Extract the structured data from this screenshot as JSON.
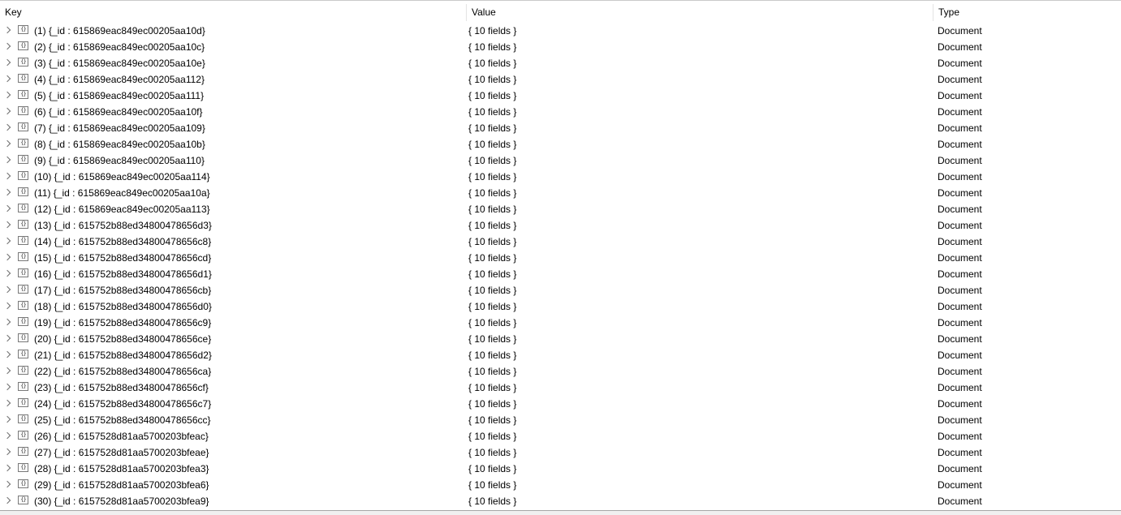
{
  "columns": {
    "key": "Key",
    "value": "Value",
    "type": "Type"
  },
  "icons": {
    "expand": "chevron-right-icon",
    "document": "curly-braces-document-icon"
  },
  "rows": [
    {
      "key": "(1) {_id : 615869eac849ec00205aa10d}",
      "value": "{ 10 fields }",
      "type": "Document"
    },
    {
      "key": "(2) {_id : 615869eac849ec00205aa10c}",
      "value": "{ 10 fields }",
      "type": "Document"
    },
    {
      "key": "(3) {_id : 615869eac849ec00205aa10e}",
      "value": "{ 10 fields }",
      "type": "Document"
    },
    {
      "key": "(4) {_id : 615869eac849ec00205aa112}",
      "value": "{ 10 fields }",
      "type": "Document"
    },
    {
      "key": "(5) {_id : 615869eac849ec00205aa111}",
      "value": "{ 10 fields }",
      "type": "Document"
    },
    {
      "key": "(6) {_id : 615869eac849ec00205aa10f}",
      "value": "{ 10 fields }",
      "type": "Document"
    },
    {
      "key": "(7) {_id : 615869eac849ec00205aa109}",
      "value": "{ 10 fields }",
      "type": "Document"
    },
    {
      "key": "(8) {_id : 615869eac849ec00205aa10b}",
      "value": "{ 10 fields }",
      "type": "Document"
    },
    {
      "key": "(9) {_id : 615869eac849ec00205aa110}",
      "value": "{ 10 fields }",
      "type": "Document"
    },
    {
      "key": "(10) {_id : 615869eac849ec00205aa114}",
      "value": "{ 10 fields }",
      "type": "Document"
    },
    {
      "key": "(11) {_id : 615869eac849ec00205aa10a}",
      "value": "{ 10 fields }",
      "type": "Document"
    },
    {
      "key": "(12) {_id : 615869eac849ec00205aa113}",
      "value": "{ 10 fields }",
      "type": "Document"
    },
    {
      "key": "(13) {_id : 615752b88ed34800478656d3}",
      "value": "{ 10 fields }",
      "type": "Document"
    },
    {
      "key": "(14) {_id : 615752b88ed34800478656c8}",
      "value": "{ 10 fields }",
      "type": "Document"
    },
    {
      "key": "(15) {_id : 615752b88ed34800478656cd}",
      "value": "{ 10 fields }",
      "type": "Document"
    },
    {
      "key": "(16) {_id : 615752b88ed34800478656d1}",
      "value": "{ 10 fields }",
      "type": "Document"
    },
    {
      "key": "(17) {_id : 615752b88ed34800478656cb}",
      "value": "{ 10 fields }",
      "type": "Document"
    },
    {
      "key": "(18) {_id : 615752b88ed34800478656d0}",
      "value": "{ 10 fields }",
      "type": "Document"
    },
    {
      "key": "(19) {_id : 615752b88ed34800478656c9}",
      "value": "{ 10 fields }",
      "type": "Document"
    },
    {
      "key": "(20) {_id : 615752b88ed34800478656ce}",
      "value": "{ 10 fields }",
      "type": "Document"
    },
    {
      "key": "(21) {_id : 615752b88ed34800478656d2}",
      "value": "{ 10 fields }",
      "type": "Document"
    },
    {
      "key": "(22) {_id : 615752b88ed34800478656ca}",
      "value": "{ 10 fields }",
      "type": "Document"
    },
    {
      "key": "(23) {_id : 615752b88ed34800478656cf}",
      "value": "{ 10 fields }",
      "type": "Document"
    },
    {
      "key": "(24) {_id : 615752b88ed34800478656c7}",
      "value": "{ 10 fields }",
      "type": "Document"
    },
    {
      "key": "(25) {_id : 615752b88ed34800478656cc}",
      "value": "{ 10 fields }",
      "type": "Document"
    },
    {
      "key": "(26) {_id : 6157528d81aa5700203bfeac}",
      "value": "{ 10 fields }",
      "type": "Document"
    },
    {
      "key": "(27) {_id : 6157528d81aa5700203bfeae}",
      "value": "{ 10 fields }",
      "type": "Document"
    },
    {
      "key": "(28) {_id : 6157528d81aa5700203bfea3}",
      "value": "{ 10 fields }",
      "type": "Document"
    },
    {
      "key": "(29) {_id : 6157528d81aa5700203bfea6}",
      "value": "{ 10 fields }",
      "type": "Document"
    },
    {
      "key": "(30) {_id : 6157528d81aa5700203bfea9}",
      "value": "{ 10 fields }",
      "type": "Document"
    }
  ]
}
